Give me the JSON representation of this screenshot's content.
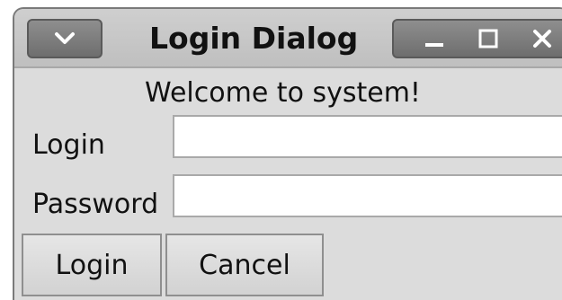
{
  "window": {
    "title": "Login Dialog"
  },
  "dialog": {
    "welcome": "Welcome to system!",
    "login_label": "Login",
    "login_value": "",
    "password_label": "Password",
    "password_value": ""
  },
  "buttons": {
    "login": "Login",
    "cancel": "Cancel"
  },
  "icons": {
    "menu": "chevron-down-icon",
    "minimize": "minimize-icon",
    "maximize": "maximize-icon",
    "close": "close-icon"
  },
  "colors": {
    "window_bg": "#dcdcdc",
    "titlebar_bg": "#c6c6c6",
    "control_bg": "#7e7e7e",
    "input_bg": "#ffffff"
  }
}
